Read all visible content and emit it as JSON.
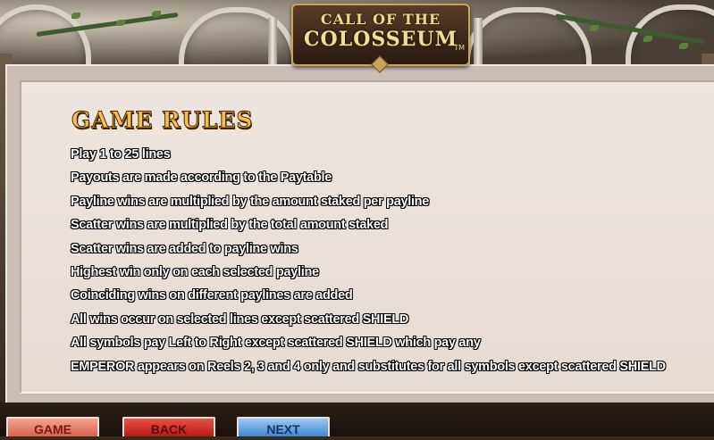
{
  "logo": {
    "line1": "CALL OF THE",
    "line2": "COLOSSEUM",
    "tm": "TM"
  },
  "rules": {
    "title": "GAME RULES",
    "items": [
      "Play 1 to 25 lines",
      "Payouts are made according to the Paytable",
      "Payline wins are multiplied by the amount staked per payline",
      "Scatter wins are multiplied by the total amount staked",
      "Scatter wins are added to payline wins",
      "Highest win only on each selected payline",
      "Coinciding wins on different paylines are added",
      "All wins occur on selected lines except scattered SHIELD",
      "All symbols pay Left to Right except scattered SHIELD which pay any",
      "EMPEROR appears on Reels 2, 3 and 4 only and substitutes for all symbols except scattered SHIELD"
    ]
  },
  "nav": {
    "game_label": "GAME",
    "back_label": "BACK",
    "next_label": "NEXT"
  },
  "colors": {
    "title": "#f2c14a",
    "panel": "#e6dbd3",
    "game_button": "#e8806c",
    "back_button": "#d03328",
    "next_button": "#6aa7e2"
  }
}
